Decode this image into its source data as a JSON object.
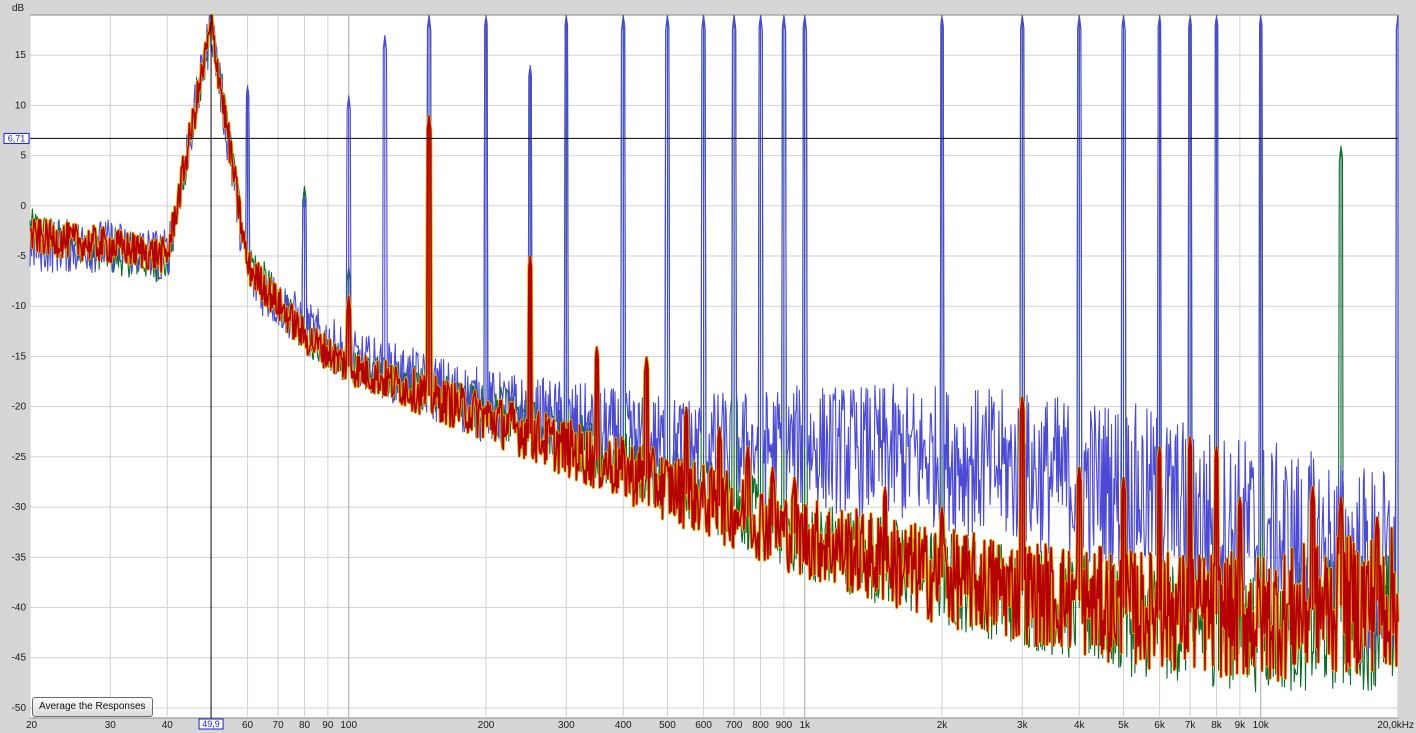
{
  "chart_data": {
    "type": "line",
    "xscale": "log",
    "xlim": [
      20,
      20000
    ],
    "ylim": [
      -51,
      19
    ],
    "yunit": "dB",
    "xunit": "kHz",
    "grid": true,
    "y_ticks": [
      {
        "value": 15,
        "label": "15"
      },
      {
        "value": 10,
        "label": "10"
      },
      {
        "value": 5,
        "label": "5"
      },
      {
        "value": 0,
        "label": "0"
      },
      {
        "value": -5,
        "label": "-5"
      },
      {
        "value": -10,
        "label": "-10"
      },
      {
        "value": -15,
        "label": "-15"
      },
      {
        "value": -20,
        "label": "-20"
      },
      {
        "value": -25,
        "label": "-25"
      },
      {
        "value": -30,
        "label": "-30"
      },
      {
        "value": -35,
        "label": "-35"
      },
      {
        "value": -40,
        "label": "-40"
      },
      {
        "value": -45,
        "label": "-45"
      },
      {
        "value": -50,
        "label": "-50"
      }
    ],
    "x_ticks": [
      {
        "value": 20,
        "label": "20"
      },
      {
        "value": 30,
        "label": "30"
      },
      {
        "value": 40,
        "label": "40"
      },
      {
        "value": 60,
        "label": "60"
      },
      {
        "value": 70,
        "label": "70"
      },
      {
        "value": 80,
        "label": "80"
      },
      {
        "value": 90,
        "label": "90"
      },
      {
        "value": 100,
        "label": "100"
      },
      {
        "value": 200,
        "label": "200"
      },
      {
        "value": 300,
        "label": "300"
      },
      {
        "value": 400,
        "label": "400"
      },
      {
        "value": 500,
        "label": "500"
      },
      {
        "value": 600,
        "label": "600"
      },
      {
        "value": 700,
        "label": "700"
      },
      {
        "value": 800,
        "label": "800"
      },
      {
        "value": 900,
        "label": "900"
      },
      {
        "value": 1000,
        "label": "1k"
      },
      {
        "value": 2000,
        "label": "2k"
      },
      {
        "value": 3000,
        "label": "3k"
      },
      {
        "value": 4000,
        "label": "4k"
      },
      {
        "value": 5000,
        "label": "5k"
      },
      {
        "value": 6000,
        "label": "6k"
      },
      {
        "value": 7000,
        "label": "7k"
      },
      {
        "value": 8000,
        "label": "8k"
      },
      {
        "value": 9000,
        "label": "9k"
      },
      {
        "value": 10000,
        "label": "10k"
      },
      {
        "value": 20000,
        "label": "20,0kHz"
      }
    ],
    "cursor": {
      "x": 49.9,
      "y": 6.71,
      "x_label": "49,9",
      "y_label": "6,71"
    },
    "series": [
      {
        "color": "#0d6b2c",
        "noise_floor": [
          [
            20,
            -2
          ],
          [
            30,
            -5
          ],
          [
            40,
            -6
          ],
          [
            50,
            18
          ],
          [
            60,
            -5
          ],
          [
            80,
            -13
          ],
          [
            100,
            -16
          ],
          [
            200,
            -20
          ],
          [
            500,
            -27
          ],
          [
            1000,
            -33
          ],
          [
            2000,
            -37
          ],
          [
            5000,
            -41
          ],
          [
            10000,
            -42
          ],
          [
            20000,
            -41
          ]
        ],
        "peaks": [
          [
            60,
            12
          ],
          [
            80,
            2
          ],
          [
            100,
            -6
          ],
          [
            150,
            19
          ],
          [
            200,
            19
          ],
          [
            250,
            14
          ],
          [
            300,
            19
          ],
          [
            400,
            19
          ],
          [
            500,
            19
          ],
          [
            600,
            19
          ],
          [
            700,
            19
          ],
          [
            800,
            19
          ],
          [
            900,
            19
          ],
          [
            1000,
            19
          ],
          [
            2000,
            19
          ],
          [
            3000,
            19
          ],
          [
            4000,
            19
          ],
          [
            5000,
            19
          ],
          [
            6000,
            19
          ],
          [
            7000,
            19
          ],
          [
            8000,
            19
          ],
          [
            10000,
            19
          ],
          [
            15000,
            6
          ],
          [
            20000,
            19
          ]
        ]
      },
      {
        "color": "#4a4ad4",
        "noise_floor": [
          [
            20,
            -4
          ],
          [
            30,
            -4
          ],
          [
            40,
            -5
          ],
          [
            50,
            18
          ],
          [
            60,
            -7
          ],
          [
            80,
            -12
          ],
          [
            100,
            -15
          ],
          [
            200,
            -20
          ],
          [
            500,
            -24
          ],
          [
            1000,
            -24
          ],
          [
            2000,
            -25
          ],
          [
            5000,
            -28
          ],
          [
            10000,
            -33
          ],
          [
            20000,
            -37
          ]
        ],
        "peaks": [
          [
            60,
            12
          ],
          [
            80,
            1
          ],
          [
            100,
            11
          ],
          [
            120,
            17
          ],
          [
            150,
            19
          ],
          [
            200,
            19
          ],
          [
            250,
            14
          ],
          [
            300,
            19
          ],
          [
            400,
            19
          ],
          [
            500,
            19
          ],
          [
            600,
            19
          ],
          [
            700,
            19
          ],
          [
            800,
            19
          ],
          [
            900,
            19
          ],
          [
            1000,
            19
          ],
          [
            2000,
            19
          ],
          [
            3000,
            19
          ],
          [
            4000,
            19
          ],
          [
            5000,
            19
          ],
          [
            6000,
            19
          ],
          [
            7000,
            19
          ],
          [
            8000,
            19
          ],
          [
            10000,
            19
          ],
          [
            20000,
            19
          ]
        ]
      },
      {
        "color": "#b40000",
        "outline": "#e8b400",
        "noise_floor": [
          [
            20,
            -3
          ],
          [
            30,
            -4
          ],
          [
            40,
            -5
          ],
          [
            50,
            18
          ],
          [
            60,
            -6
          ],
          [
            80,
            -13
          ],
          [
            100,
            -16
          ],
          [
            200,
            -21
          ],
          [
            500,
            -28
          ],
          [
            1000,
            -33
          ],
          [
            2000,
            -37
          ],
          [
            5000,
            -40
          ],
          [
            10000,
            -41
          ],
          [
            20000,
            -39
          ]
        ],
        "peaks": [
          [
            100,
            -9
          ],
          [
            150,
            9
          ],
          [
            250,
            -5
          ],
          [
            350,
            -14
          ],
          [
            450,
            -15
          ],
          [
            550,
            -20
          ],
          [
            650,
            -22
          ],
          [
            750,
            -24
          ],
          [
            850,
            -26
          ],
          [
            950,
            -27
          ],
          [
            1500,
            -28
          ],
          [
            2000,
            -30
          ],
          [
            3000,
            -19
          ],
          [
            4000,
            -26
          ],
          [
            5000,
            -27
          ],
          [
            6000,
            -24
          ],
          [
            7000,
            -23
          ],
          [
            8000,
            -24
          ],
          [
            9000,
            -29
          ],
          [
            13000,
            -28
          ],
          [
            15000,
            -29
          ],
          [
            18000,
            -31
          ]
        ]
      }
    ]
  },
  "ui": {
    "average_button_label": "Average the Responses"
  }
}
